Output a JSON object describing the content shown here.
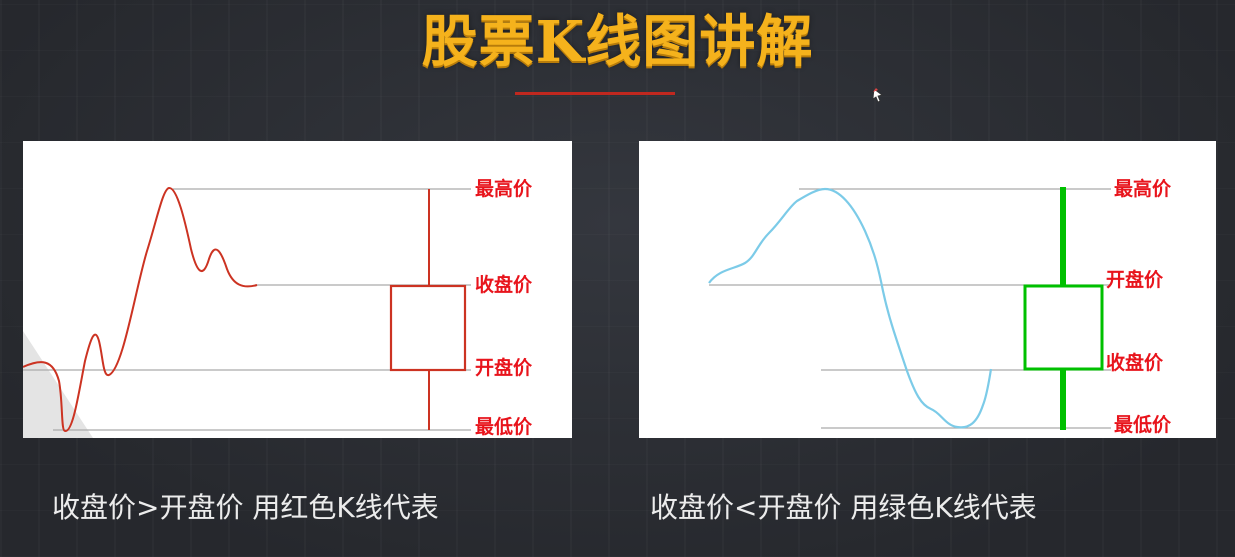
{
  "title": "股票K线图讲解",
  "colors": {
    "title": "#f5b21c",
    "underline": "#c0281f",
    "red_candle": "#cc3322",
    "green_candle": "#00c000",
    "price_curve_left": "#cc3322",
    "price_curve_right": "#7ccbe8",
    "label_text": "#e8141c",
    "caption_text": "#ececec"
  },
  "left_panel": {
    "labels": {
      "high": "最高价",
      "close": "收盘价",
      "open": "开盘价",
      "low": "最低价"
    }
  },
  "right_panel": {
    "labels": {
      "high": "最高价",
      "open": "开盘价",
      "close": "收盘价",
      "low": "最低价"
    }
  },
  "captions": {
    "left": "收盘价>开盘价 用红色K线代表",
    "right": "收盘价<开盘价  用绿色K线代表"
  }
}
